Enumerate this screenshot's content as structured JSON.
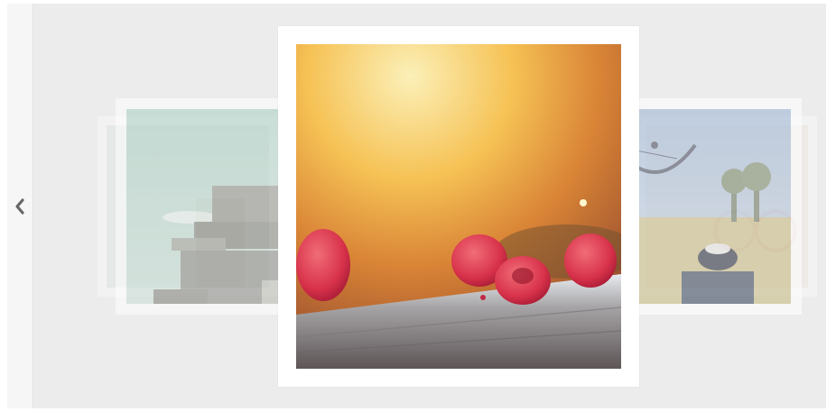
{
  "carousel": {
    "prev_control": {
      "icon": "chevron-left-icon",
      "color": "#666666"
    },
    "slides": [
      {
        "position": "far-left",
        "subject": "building"
      },
      {
        "position": "left",
        "subject": "concrete-building"
      },
      {
        "position": "center",
        "subject": "raspberries"
      },
      {
        "position": "right",
        "subject": "dreamcatcher-sneakers"
      },
      {
        "position": "far-right",
        "subject": "bicycle"
      }
    ],
    "colors": {
      "background": "#ececec",
      "card_border": "#ffffff",
      "rail": "#f6f6f6"
    }
  }
}
